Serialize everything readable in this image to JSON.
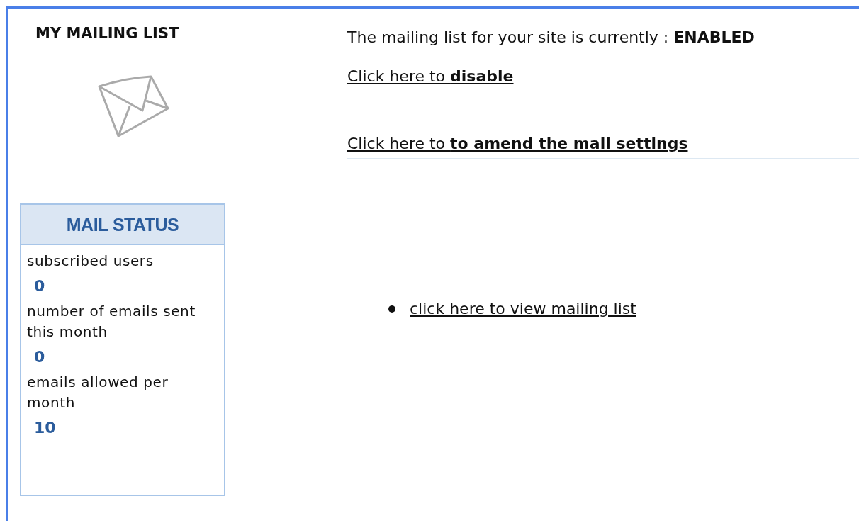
{
  "title": "MY MAILING LIST",
  "mail_status": {
    "heading": "MAIL STATUS",
    "stats": [
      {
        "label": "subscribed users",
        "value": "0"
      },
      {
        "label": "number of emails sent this month",
        "value": "0"
      },
      {
        "label": "emails allowed per month",
        "value": "10"
      }
    ]
  },
  "status_line": "The mailing list for your site is currently : **ENABLED**",
  "links": [
    "Click here to **disable**",
    "Click here to **to amend the mail settings**"
  ],
  "list_links": [
    "click here to view mailing list"
  ]
}
